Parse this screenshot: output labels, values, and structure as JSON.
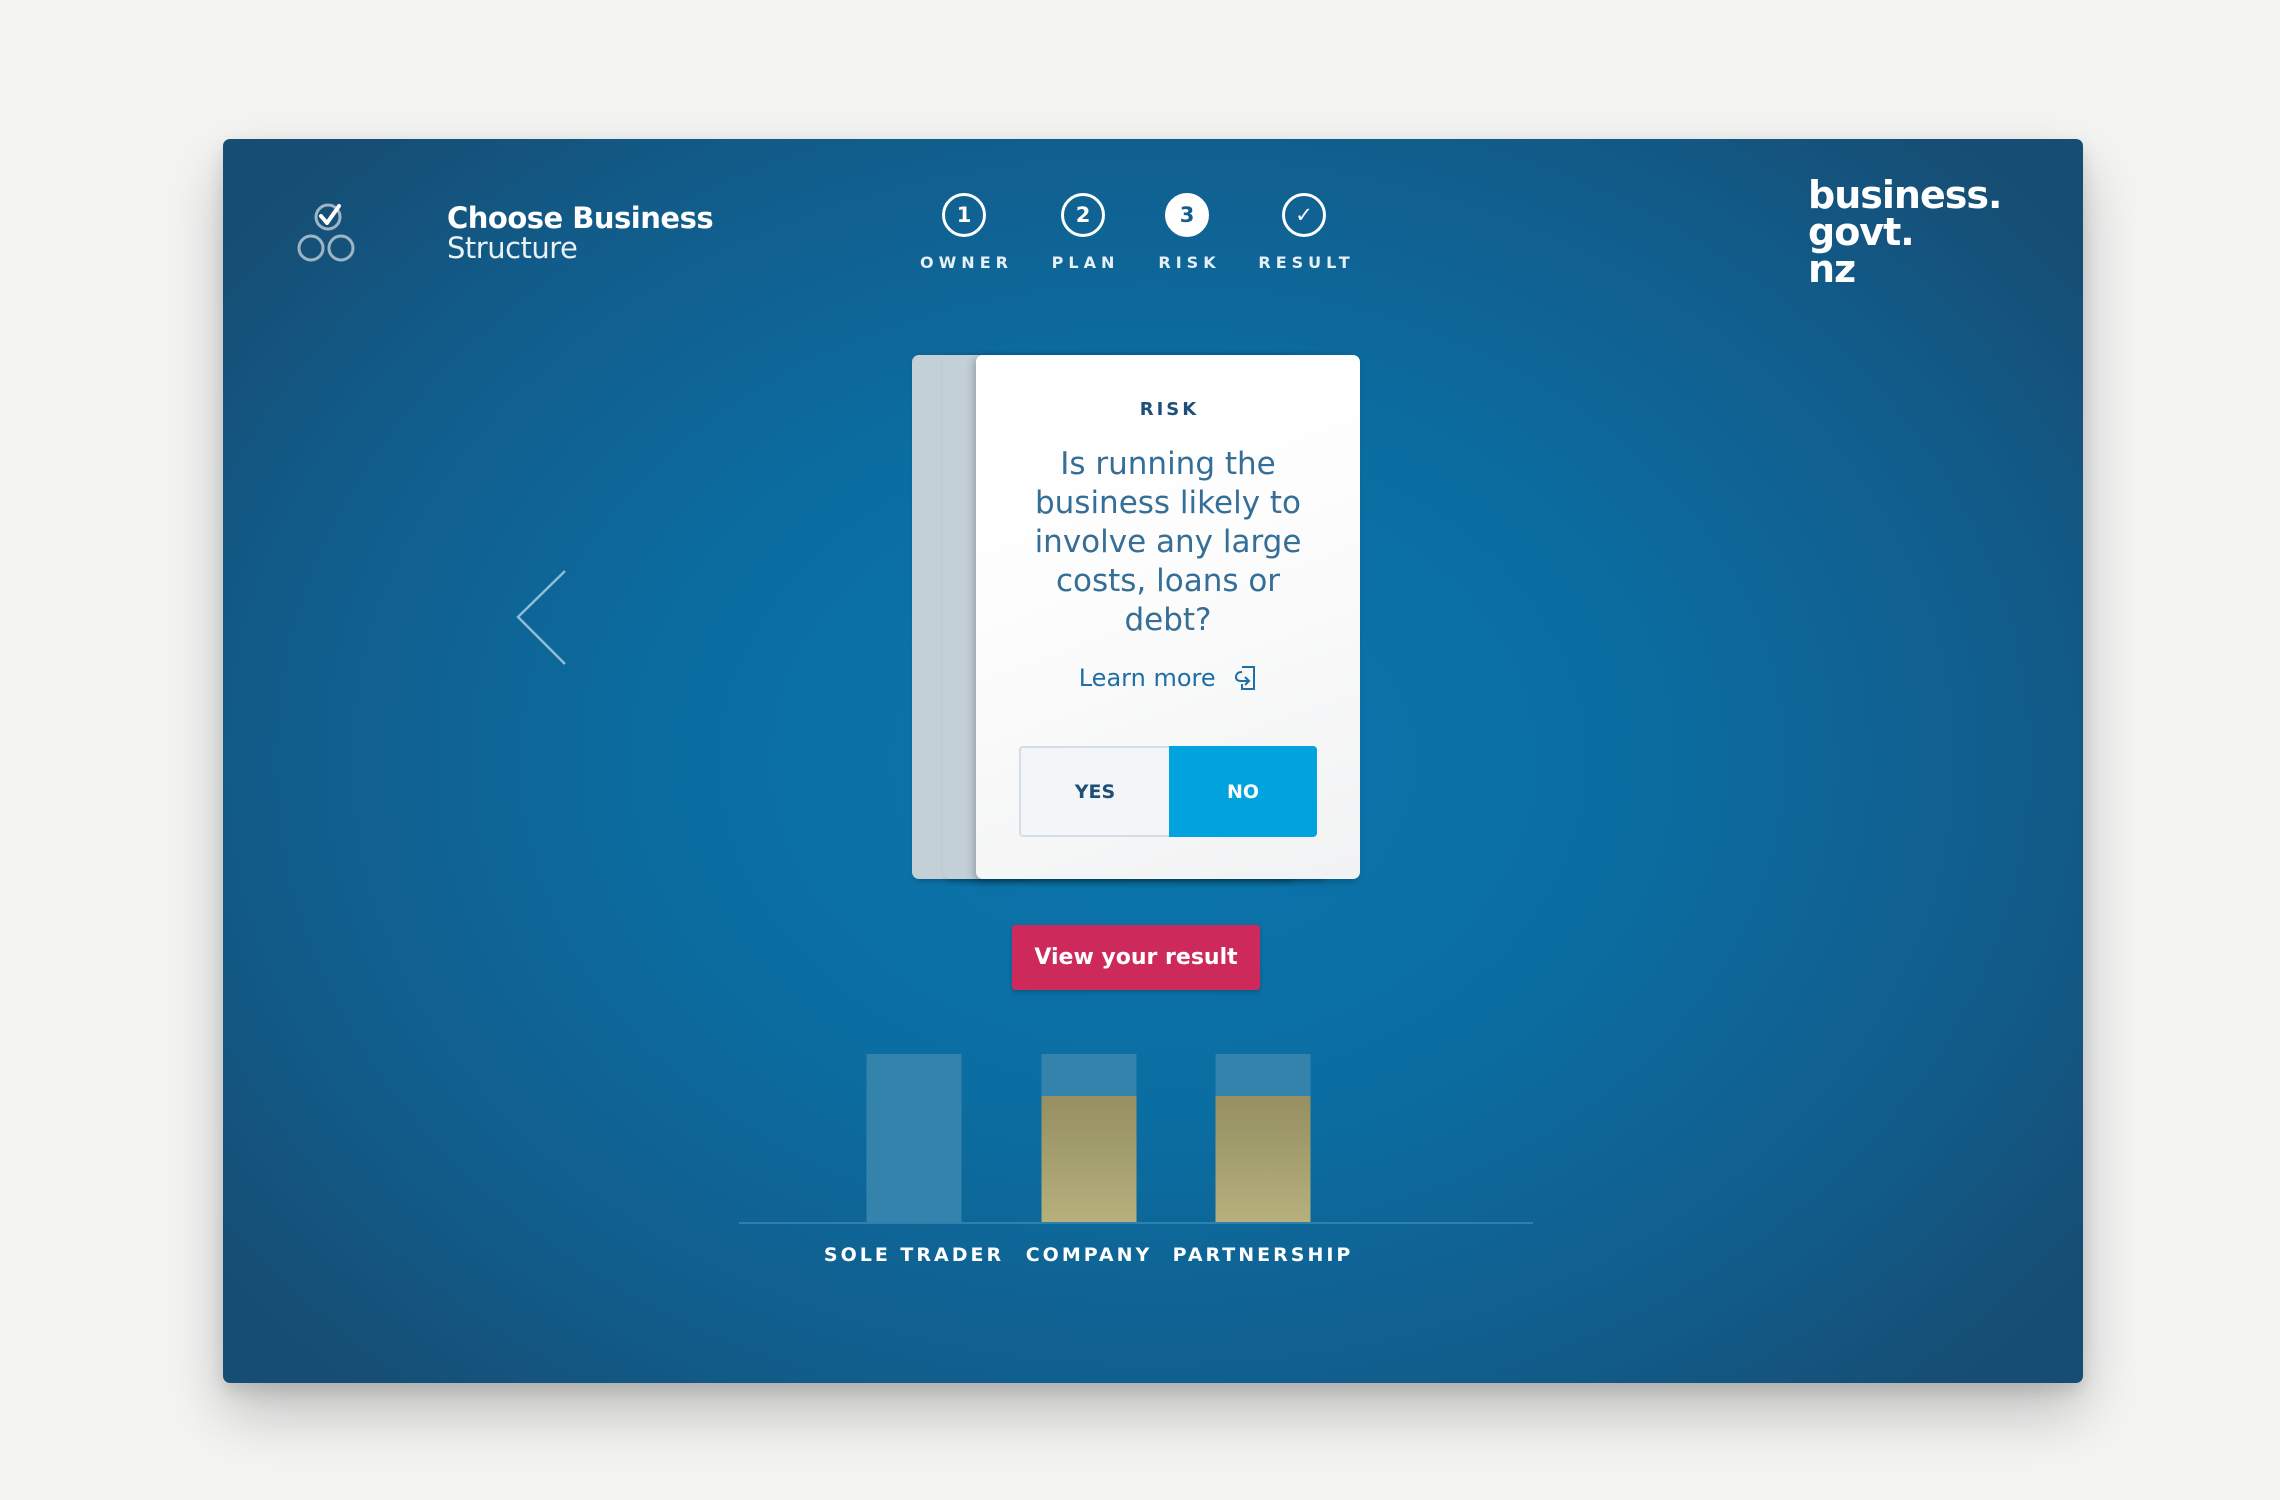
{
  "brand": {
    "title": "Choose Business",
    "subtitle": "Structure",
    "icon": "checked-circles-icon"
  },
  "govt_logo": {
    "lines": [
      "business.",
      "govt.",
      "nz"
    ]
  },
  "stepper": {
    "steps": [
      {
        "number": "1",
        "label": "OWNER",
        "state": "done"
      },
      {
        "number": "2",
        "label": "PLAN",
        "state": "done"
      },
      {
        "number": "3",
        "label": "RISK",
        "state": "active"
      },
      {
        "number": "✓",
        "label": "RESULT",
        "state": "pending"
      }
    ]
  },
  "nav": {
    "prev_icon": "chevron-left-icon"
  },
  "question_card": {
    "category": "RISK",
    "question": "Is running the business likely to involve any large costs, loans or debt?",
    "learn_more_label": "Learn more",
    "learn_more_icon": "external-link-icon",
    "options": [
      {
        "label": "YES",
        "selected": false
      },
      {
        "label": "NO",
        "selected": true
      }
    ]
  },
  "cta": {
    "label": "View your result"
  },
  "colors": {
    "panel_blue": "#0b6ea2",
    "selected_option": "#00a3dd",
    "cta": "#cd2a5b",
    "bar_track": "#3383ac",
    "bar_fill": "#b5b07c"
  },
  "chart_data": {
    "type": "bar",
    "categories": [
      "SOLE TRADER",
      "COMPANY",
      "PARTNERSHIP"
    ],
    "values": [
      0,
      0.75,
      0.75
    ],
    "ylim": [
      0,
      1
    ],
    "title": "",
    "xlabel": "",
    "ylabel": "",
    "grid": false
  }
}
